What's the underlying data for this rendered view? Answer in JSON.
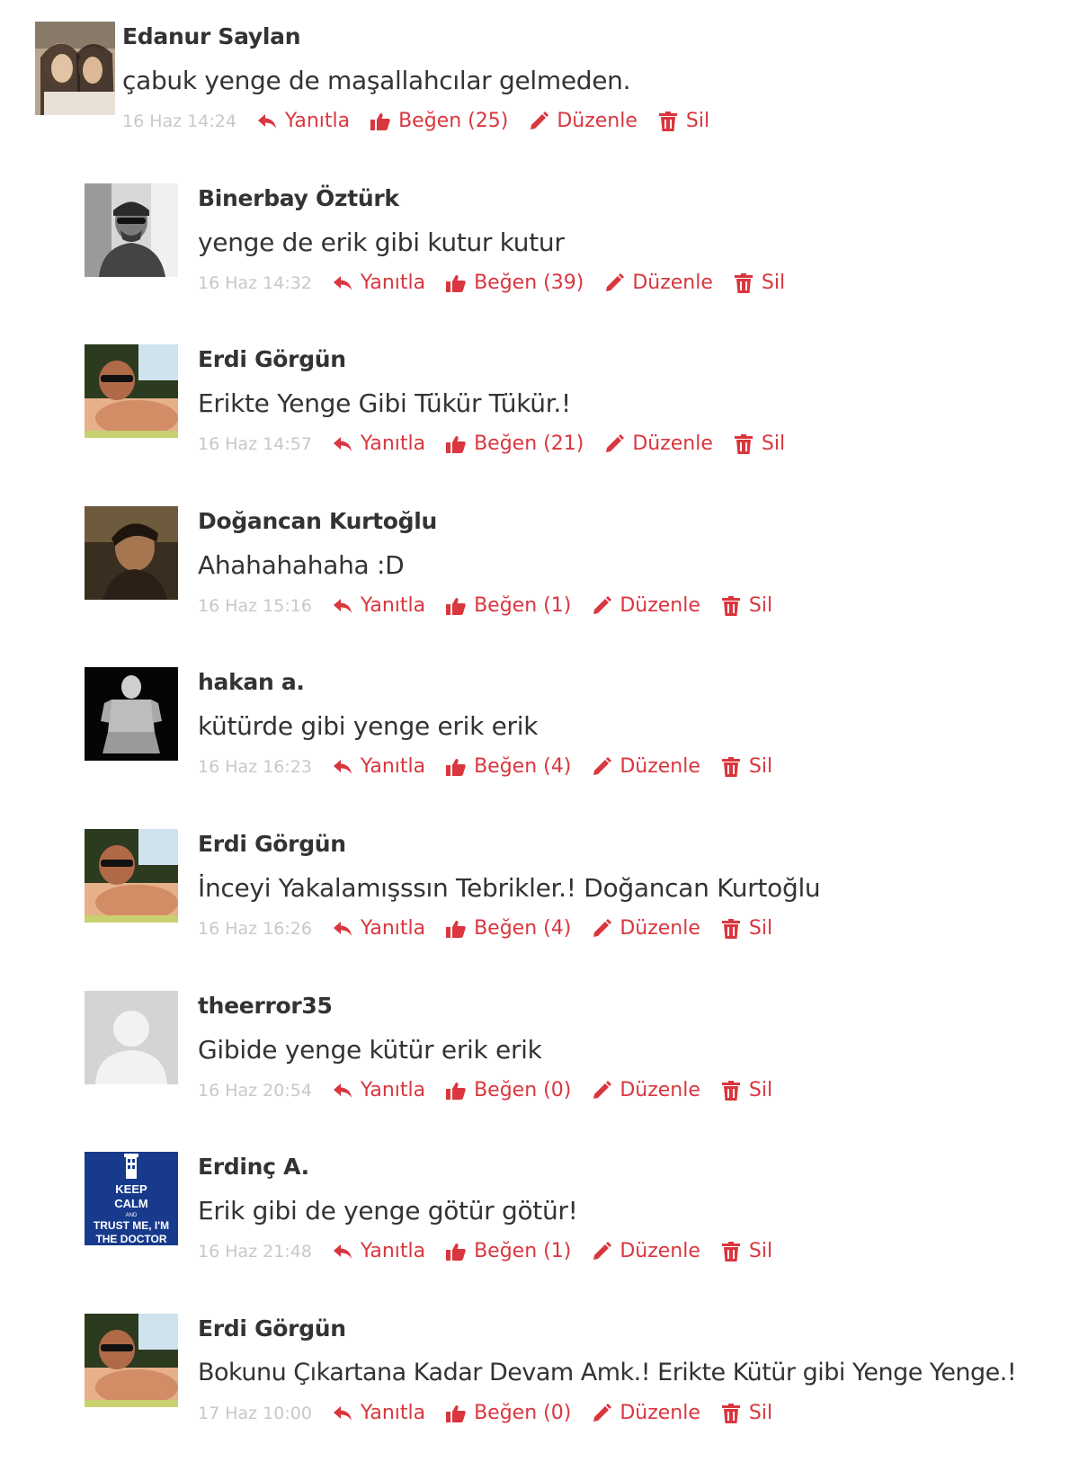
{
  "colors": {
    "accent": "#d9363e",
    "time": "#c8c8c8",
    "text": "#333333"
  },
  "icons": {
    "reply": "reply-icon",
    "like": "thumbs-up-icon",
    "edit": "pencil-icon",
    "delete": "trash-icon"
  },
  "actions": {
    "reply": "Yanıtla",
    "like_prefix": "Beğen",
    "edit": "Düzenle",
    "delete": "Sil"
  },
  "comments": [
    {
      "author": "Edanur Saylan",
      "text": "çabuk yenge de maşallahcılar gelmeden.",
      "time": "16 Haz 14:24",
      "likes": "Beğen (25)"
    },
    {
      "author": "Binerbay Öztürk",
      "text": "yenge de erik gibi kutur kutur",
      "time": "16 Haz 14:32",
      "likes": "Beğen (39)"
    },
    {
      "author": "Erdi Görgün",
      "text": "Erikte Yenge Gibi Tükür Tükür.!",
      "time": "16 Haz 14:57",
      "likes": "Beğen (21)"
    },
    {
      "author": "Doğancan Kurtoğlu",
      "text": "Ahahahahaha :D",
      "time": "16 Haz 15:16",
      "likes": "Beğen (1)"
    },
    {
      "author": "hakan a.",
      "text": "kütürde gibi yenge erik erik",
      "time": "16 Haz 16:23",
      "likes": "Beğen (4)"
    },
    {
      "author": "Erdi Görgün",
      "text": "İnceyi Yakalamışssın Tebrikler.! Doğancan Kurtoğlu",
      "time": "16 Haz 16:26",
      "likes": "Beğen (4)"
    },
    {
      "author": "theerror35",
      "text": "Gibide yenge kütür erik erik",
      "time": "16 Haz 20:54",
      "likes": "Beğen (0)"
    },
    {
      "author": "Erdinç A.",
      "text": "Erik gibi de yenge götür götür!",
      "time": "16 Haz 21:48",
      "likes": "Beğen (1)",
      "avatar_text": [
        "KEEP",
        "CALM",
        "AND",
        "TRUST ME, I'M",
        "THE DOCTOR"
      ]
    },
    {
      "author": "Erdi Görgün",
      "text": "Bokunu Çıkartana Kadar Devam Amk.! Erikte Kütür gibi Yenge Yenge.!",
      "time": "17 Haz 10:00",
      "likes": "Beğen (0)"
    }
  ]
}
